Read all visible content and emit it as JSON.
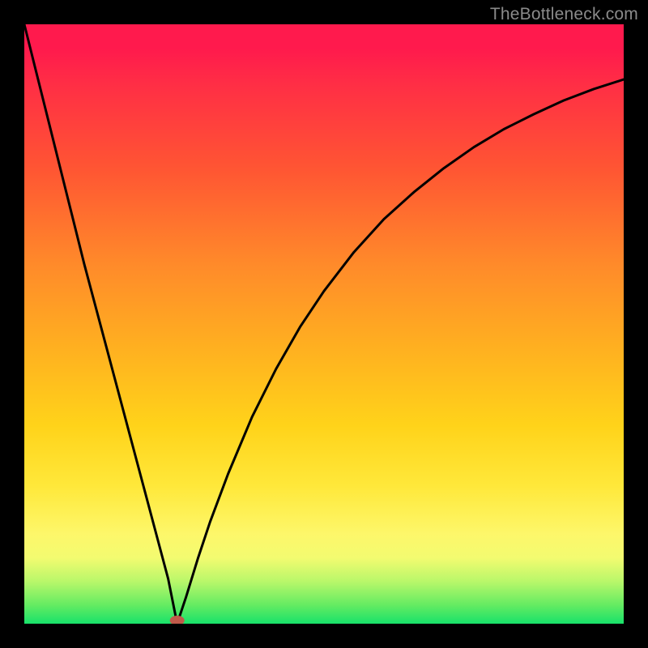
{
  "watermark": "TheBottleneck.com",
  "chart_data": {
    "type": "line",
    "title": "",
    "xlabel": "",
    "ylabel": "",
    "xlim": [
      0,
      100
    ],
    "ylim": [
      0,
      100
    ],
    "grid": false,
    "legend": false,
    "background_gradient": {
      "top": "#ff1a4d",
      "middle": "#ffd31a",
      "bottom": "#18e26a"
    },
    "minimum_marker": {
      "x": 25.5,
      "y": 0,
      "color": "#c05a4a"
    },
    "series": [
      {
        "name": "curve",
        "color": "#000000",
        "x": [
          0,
          2,
          4,
          6,
          8,
          10,
          12,
          14,
          16,
          18,
          20,
          22,
          24,
          25.5,
          27,
          29,
          31,
          34,
          38,
          42,
          46,
          50,
          55,
          60,
          65,
          70,
          75,
          80,
          85,
          90,
          95,
          100
        ],
        "y": [
          100,
          92,
          84,
          76,
          68,
          60,
          52.5,
          45,
          37.5,
          30,
          22.5,
          15,
          7.5,
          0,
          4.5,
          11,
          17,
          25,
          34.5,
          42.5,
          49.5,
          55.5,
          62,
          67.5,
          72,
          76,
          79.5,
          82.5,
          85,
          87.3,
          89.2,
          90.8
        ]
      }
    ]
  }
}
